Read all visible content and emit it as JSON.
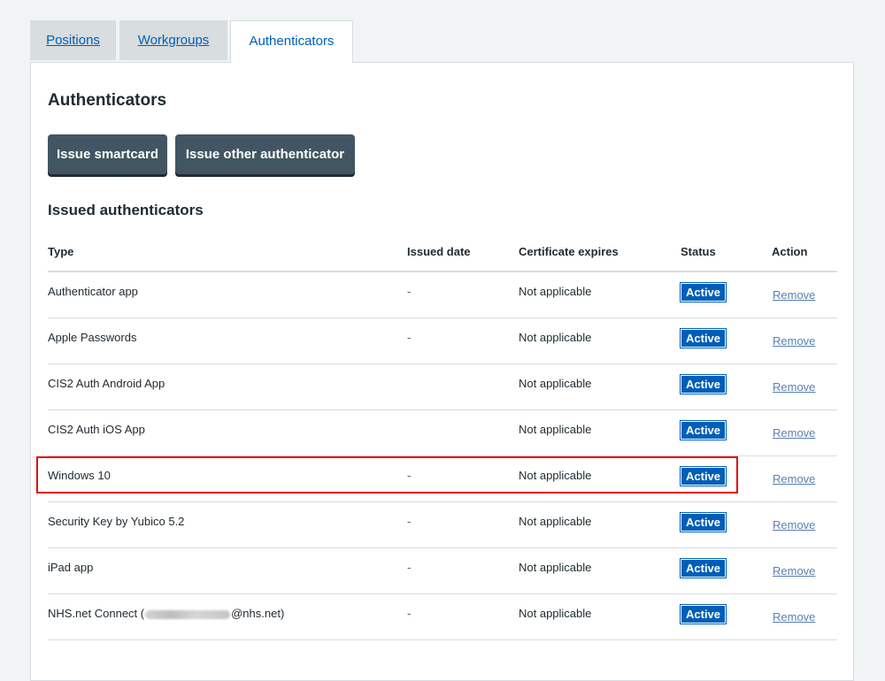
{
  "tabs": [
    {
      "label": "Positions"
    },
    {
      "label": "Workgroups"
    },
    {
      "label": "Authenticators"
    }
  ],
  "page": {
    "title": "Authenticators",
    "buttons": {
      "issue_smartcard": "Issue smartcard",
      "issue_other": "Issue other authenticator"
    },
    "section_title": "Issued authenticators"
  },
  "table": {
    "headers": {
      "type": "Type",
      "issued_date": "Issued date",
      "certificate_expires": "Certificate expires",
      "status": "Status",
      "action": "Action"
    },
    "rows": [
      {
        "type": "Authenticator app",
        "issued_date": "-",
        "certificate_expires": "Not applicable",
        "status": "Active",
        "action": "Remove"
      },
      {
        "type": "Apple Passwords",
        "issued_date": "-",
        "certificate_expires": "Not applicable",
        "status": "Active",
        "action": "Remove"
      },
      {
        "type": "CIS2 Auth Android App",
        "issued_date": "",
        "certificate_expires": "Not applicable",
        "status": "Active",
        "action": "Remove"
      },
      {
        "type": "CIS2 Auth iOS App",
        "issued_date": "",
        "certificate_expires": "Not applicable",
        "status": "Active",
        "action": "Remove"
      },
      {
        "type": "Windows 10",
        "issued_date": "-",
        "certificate_expires": "Not applicable",
        "status": "Active",
        "action": "Remove"
      },
      {
        "type": "Security Key by Yubico 5.2",
        "issued_date": "-",
        "certificate_expires": "Not applicable",
        "status": "Active",
        "action": "Remove"
      },
      {
        "type": "iPad app",
        "issued_date": "-",
        "certificate_expires": "Not applicable",
        "status": "Active",
        "action": "Remove"
      },
      {
        "type_prefix": "NHS.net Connect (",
        "type_suffix": "@nhs.net)",
        "issued_date": "-",
        "certificate_expires": "Not applicable",
        "status": "Active",
        "action": "Remove"
      }
    ]
  },
  "colors": {
    "primary_blue": "#005eb8",
    "button_grey": "#425563",
    "highlight_red": "#e4060a"
  }
}
